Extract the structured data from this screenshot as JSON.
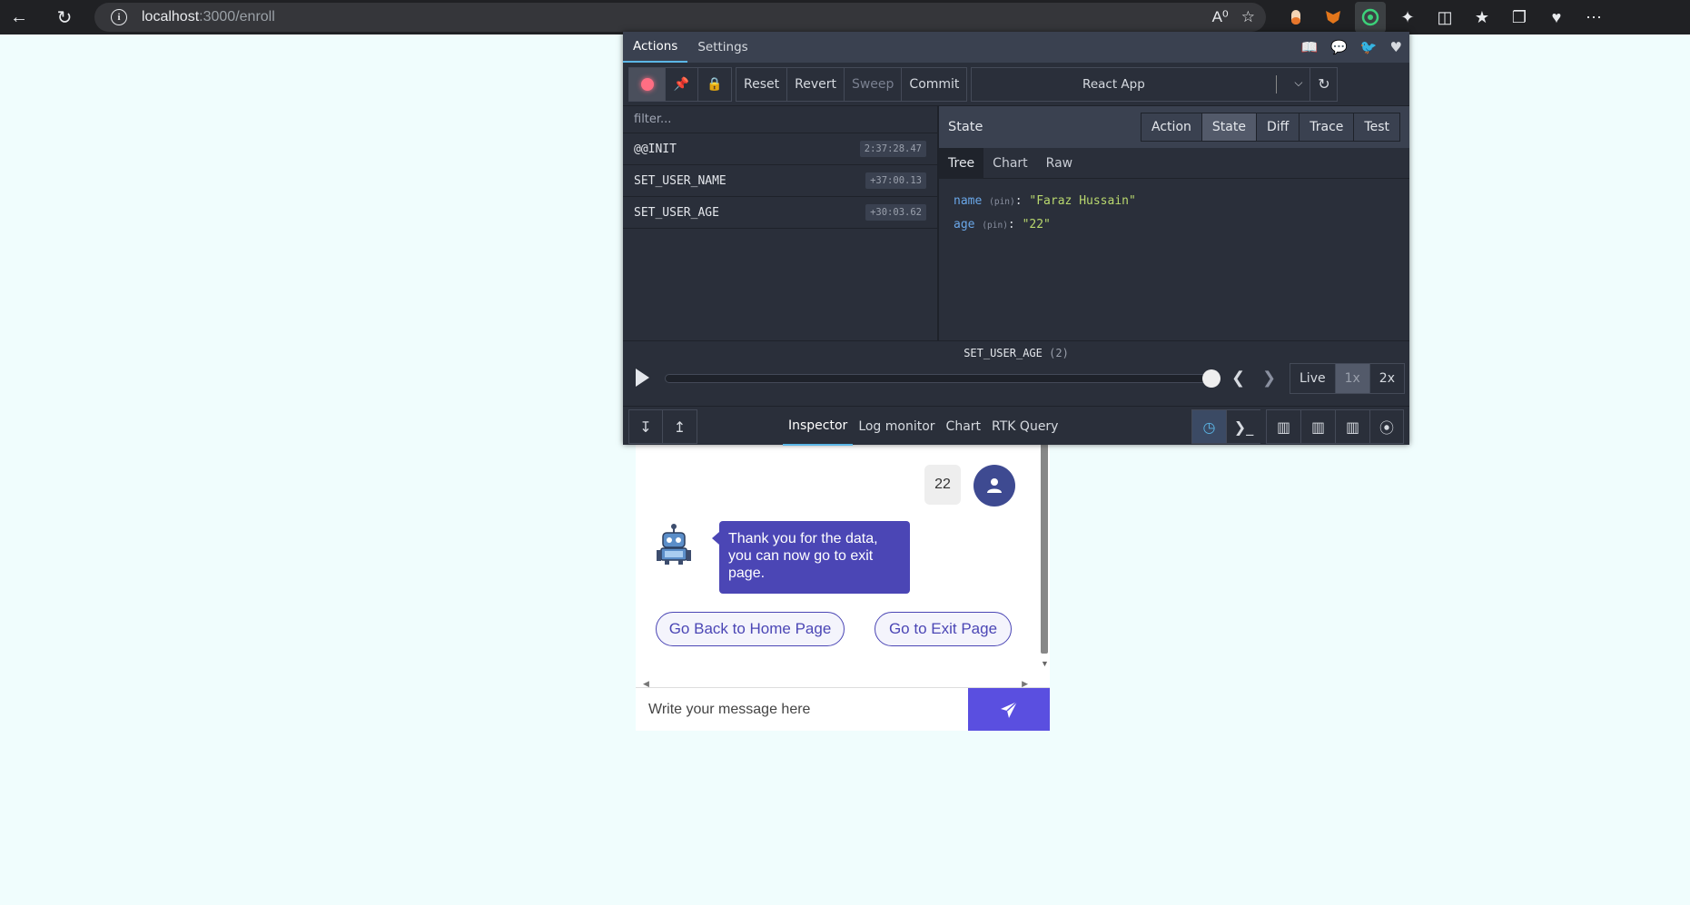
{
  "browser": {
    "url_host": "localhost",
    "url_path": ":3000/enroll",
    "info_icon": "i"
  },
  "devtools": {
    "tabs": [
      "Actions",
      "Settings"
    ],
    "toolbar": {
      "reset": "Reset",
      "revert": "Revert",
      "sweep": "Sweep",
      "commit": "Commit",
      "instance": "React App"
    },
    "filter_placeholder": "filter...",
    "actions": [
      {
        "type": "@@INIT",
        "time": "2:37:28.47"
      },
      {
        "type": "SET_USER_NAME",
        "time": "+37:00.13"
      },
      {
        "type": "SET_USER_AGE",
        "time": "+30:03.62"
      }
    ],
    "inspector": {
      "title": "State",
      "modes": [
        "Action",
        "State",
        "Diff",
        "Trace",
        "Test"
      ],
      "active_mode": "State",
      "sub_tabs": [
        "Tree",
        "Chart",
        "Raw"
      ],
      "state": [
        {
          "key": "name",
          "pin": "(pin)",
          "value": "\"Faraz Hussain\""
        },
        {
          "key": "age",
          "pin": "(pin)",
          "value": "\"22\""
        }
      ]
    },
    "slider": {
      "label": "SET_USER_AGE",
      "count": "(2)",
      "speeds": [
        "Live",
        "1x",
        "2x"
      ],
      "position": 1.0
    },
    "monitors": [
      "Inspector",
      "Log monitor",
      "Chart",
      "RTK Query"
    ]
  },
  "chat": {
    "user_message": "22",
    "bot_message": "Thank you for the data, you can now go to exit page.",
    "home_button": "Go Back to Home Page",
    "exit_button": "Go to Exit Page",
    "input_placeholder": "Write your message here"
  },
  "colors": {
    "bot_bubble": "#4b46b5",
    "send_button": "#5a4fe0",
    "page_bg": "#f0fdfd",
    "devtools_bg": "#2a2f3a"
  }
}
